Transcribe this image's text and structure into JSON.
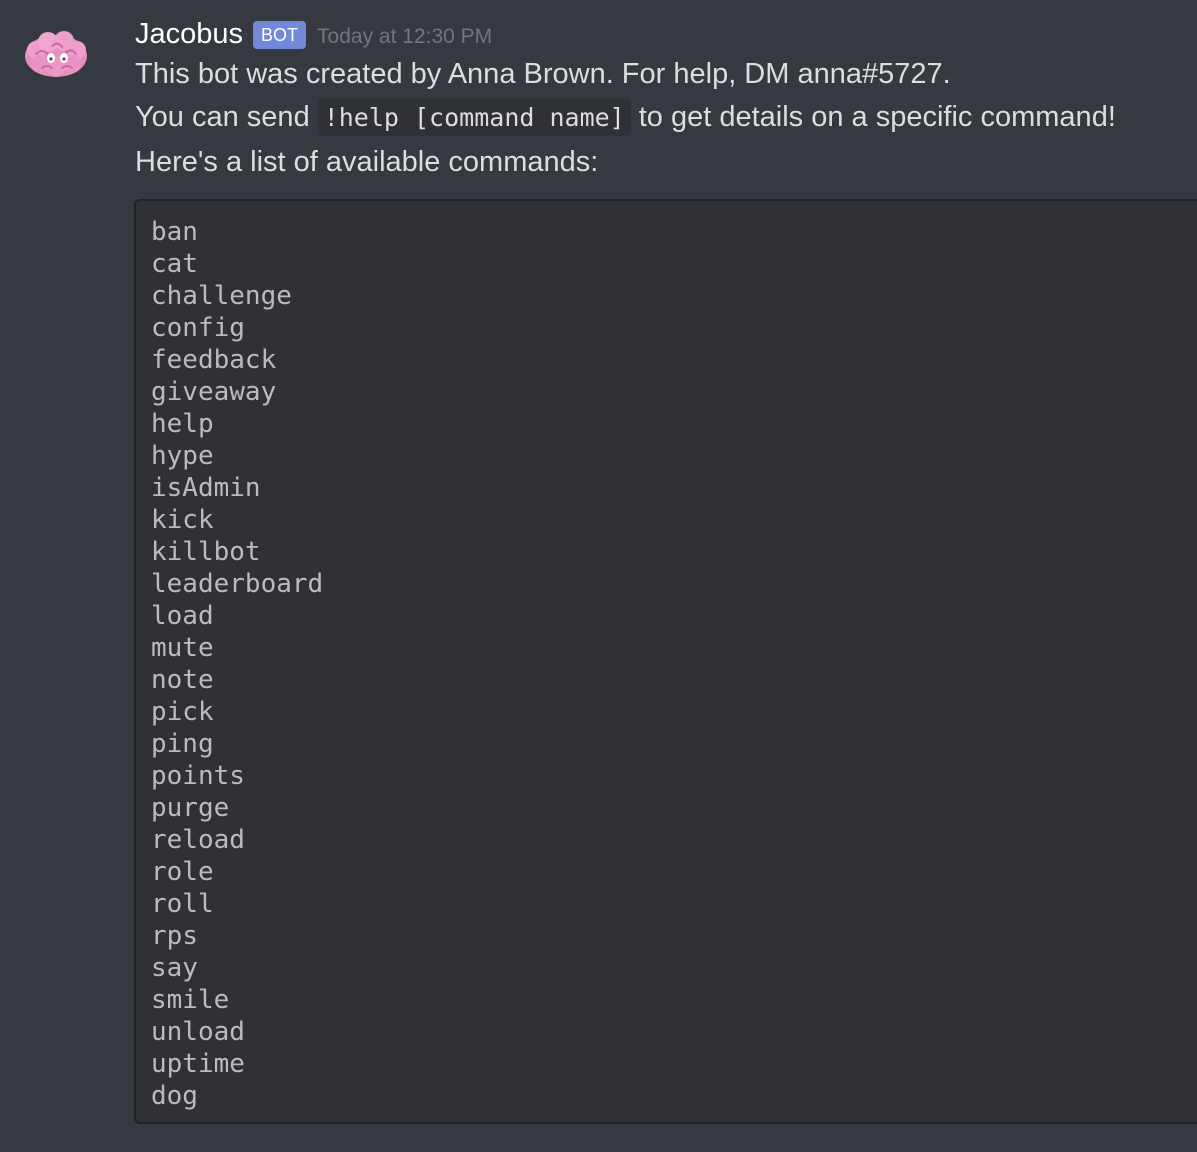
{
  "message": {
    "author": "Jacobus",
    "bot_tag": "BOT",
    "timestamp": "Today at 12:30 PM",
    "avatar_icon": "pink-brain-avatar",
    "line1": "This bot was created by Anna Brown. For help, DM anna#5727.",
    "line2_before": "You can send",
    "line2_code": "!help [command name]",
    "line2_after": "to get details on a specific command!",
    "line3": "Here's a list of available commands:",
    "commands": [
      "ban",
      "cat",
      "challenge",
      "config",
      "feedback",
      "giveaway",
      "help",
      "hype",
      "isAdmin",
      "kick",
      "killbot",
      "leaderboard",
      "load",
      "mute",
      "note",
      "pick",
      "ping",
      "points",
      "purge",
      "reload",
      "role",
      "roll",
      "rps",
      "say",
      "smile",
      "unload",
      "uptime",
      "dog"
    ]
  },
  "colors": {
    "background": "#36393f",
    "code_background": "#2f3136",
    "bot_tag": "#7289da",
    "timestamp": "#72767d",
    "text": "#dcddde"
  }
}
